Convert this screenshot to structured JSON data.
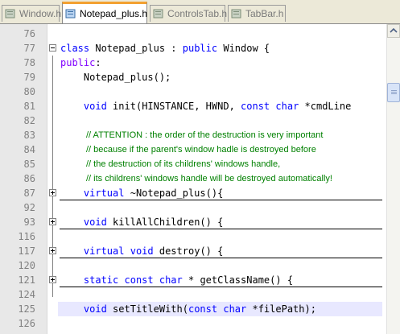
{
  "tabs": [
    {
      "label": "Window.h",
      "active": false,
      "icon": "file-icon"
    },
    {
      "label": "Notepad_plus.h",
      "active": true,
      "icon": "file-icon"
    },
    {
      "label": "ControlsTab.h",
      "active": false,
      "icon": "file-icon"
    },
    {
      "label": "TabBar.h",
      "active": false,
      "icon": "file-icon"
    }
  ],
  "colors": {
    "keyword": "#0000ff",
    "comment": "#008000",
    "caret_line": "#e8e8ff",
    "active_tab_accent": "#f3a030"
  },
  "editor": {
    "lines": [
      {
        "num": "76",
        "text": ""
      },
      {
        "num": "77",
        "text": "class Notepad_plus : public Window {"
      },
      {
        "num": "78",
        "text": "public:"
      },
      {
        "num": "79",
        "text": "    Notepad_plus();"
      },
      {
        "num": "80",
        "text": ""
      },
      {
        "num": "81",
        "text": "    void init(HINSTANCE, HWND, const char *cmdLine"
      },
      {
        "num": "82",
        "text": ""
      },
      {
        "num": "83",
        "text": "// ATTENTION : the order of the destruction is very important"
      },
      {
        "num": "84",
        "text": "// because if the parent's window hadle is destroyed before"
      },
      {
        "num": "85",
        "text": "// the destruction of its childrens' windows handle,"
      },
      {
        "num": "86",
        "text": "// its childrens' windows handle will be destroyed automatically!"
      },
      {
        "num": "87",
        "text": "    virtual ~Notepad_plus(){"
      },
      {
        "num": "92",
        "text": ""
      },
      {
        "num": "93",
        "text": "    void killAllChildren() {"
      },
      {
        "num": "116",
        "text": ""
      },
      {
        "num": "117",
        "text": "    virtual void destroy() {"
      },
      {
        "num": "120",
        "text": ""
      },
      {
        "num": "121",
        "text": "    static const char * getClassName() {"
      },
      {
        "num": "124",
        "text": ""
      },
      {
        "num": "125",
        "text": "    void setTitleWith(const char *filePath);"
      },
      {
        "num": "126",
        "text": ""
      }
    ]
  }
}
